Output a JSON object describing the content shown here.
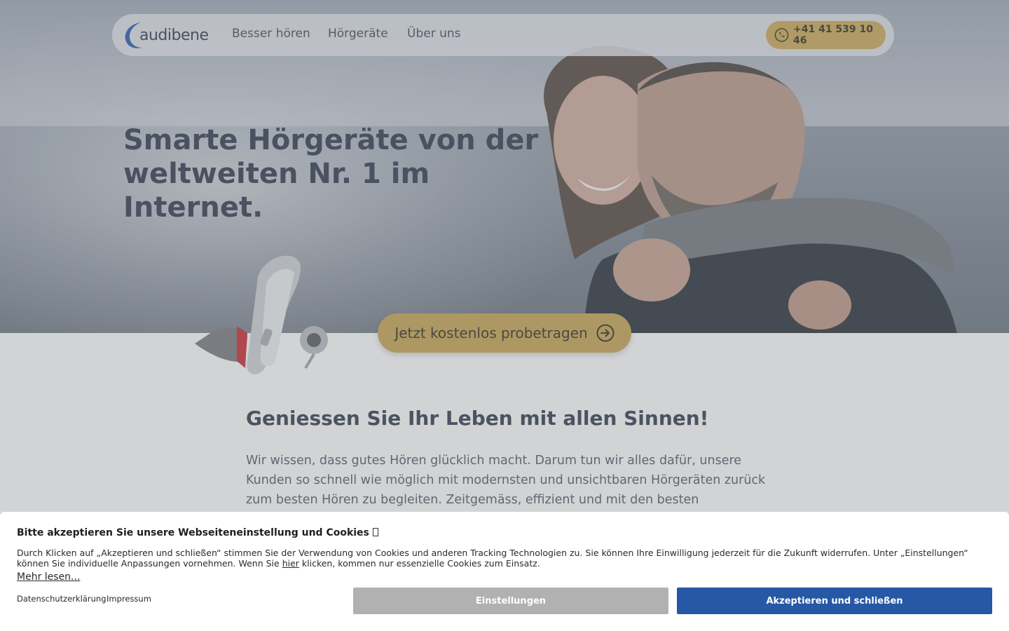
{
  "brand": {
    "logo_text": "audibene"
  },
  "nav": {
    "links": [
      "Besser hören",
      "Hörgeräte",
      "Über uns"
    ],
    "phone": "+41 41 539 10 46"
  },
  "hero": {
    "headline_line1": "Smarte Hörgeräte von der",
    "headline_line2": "weltweiten Nr. 1 im Internet.",
    "cta_label": "Jetzt kostenlos probetragen"
  },
  "content": {
    "title": "Geniessen Sie Ihr Leben mit allen Sinnen!",
    "text": "Wir wissen, dass gutes Hören glücklich macht. Darum tun wir alles dafür, unsere Kunden so schnell wie möglich mit modernsten und unsichtbaren Hörgeräten zurück zum besten Hören zu begleiten. Zeitgemäss, effizient und mit den besten"
  },
  "cookie": {
    "title": "Bitte akzeptieren Sie unsere Webseiteneinstellung und Cookies",
    "text_part1": "Durch Klicken auf „Akzeptieren und schließen“ stimmen Sie der Verwendung von Cookies und anderen Tracking Technologien zu. Sie können Ihre Einwilligung jederzeit für die Zukunft widerrufen. Unter „Einstellungen“ können Sie individuelle Anpassungen vornehmen. Wenn Sie ",
    "text_link": "hier",
    "text_part2": " klicken, kommen nur essenzielle Cookies zum Einsatz.",
    "mehr_lesen": "Mehr lesen...",
    "privacy_link": "Datenschutzerklärung",
    "imprint_link": "Impressum",
    "settings_button": "Einstellungen",
    "accept_button": "Akzeptieren und schließen"
  },
  "colors": {
    "accent_gold": "#c3a256",
    "accept_blue": "#2658a6",
    "settings_gray": "#b1b1b1",
    "text_dark": "#3c4352"
  },
  "icons": [
    "audibene-logo-icon",
    "phone-icon",
    "arrow-right-circle-icon"
  ]
}
